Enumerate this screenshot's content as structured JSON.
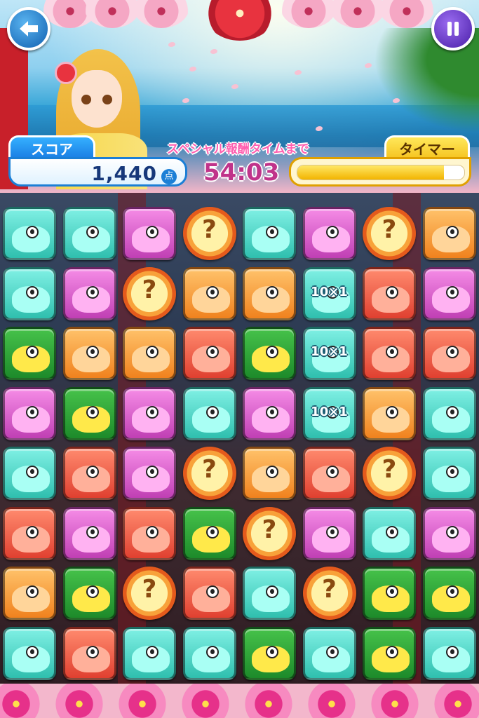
{
  "hud": {
    "score_label": "スコア",
    "score_value": "1,440",
    "score_unit": "点",
    "special_label": "スペシャル報酬タイムまで",
    "special_timer": "54:03",
    "timer_label": "タイマー",
    "timer_fraction": 0.88
  },
  "buttons": {
    "back_icon": "arrow-left-icon",
    "pause_icon": "pause-icon"
  },
  "colors": {
    "teal": "#2fbfae",
    "pink": "#c03fb4",
    "orange": "#f0821e",
    "red": "#e04030",
    "green": "#1d8a2a",
    "mystery": "#f8a23a"
  },
  "board": {
    "rows": 8,
    "cols": 8,
    "mystery_text": "?",
    "bonus_text": "10×1",
    "tiles": [
      [
        "teal",
        "teal",
        "pink",
        "mystery",
        "teal",
        "pink",
        "mystery",
        "orange"
      ],
      [
        "teal",
        "pink",
        "mystery",
        "orange",
        "orange",
        "teal-bonus",
        "red",
        "pink"
      ],
      [
        "green",
        "orange",
        "orange",
        "red",
        "green",
        "teal-bonus",
        "red",
        "red"
      ],
      [
        "pink",
        "green",
        "pink",
        "teal",
        "pink",
        "teal-bonus",
        "orange",
        "teal"
      ],
      [
        "teal",
        "red",
        "pink",
        "mystery",
        "orange",
        "red",
        "mystery",
        "teal"
      ],
      [
        "red",
        "pink",
        "red",
        "green",
        "mystery",
        "pink",
        "teal",
        "pink"
      ],
      [
        "orange",
        "green",
        "mystery",
        "red",
        "teal",
        "mystery",
        "green",
        "green"
      ],
      [
        "teal",
        "red",
        "teal",
        "teal",
        "green",
        "teal",
        "green",
        "teal"
      ]
    ]
  }
}
